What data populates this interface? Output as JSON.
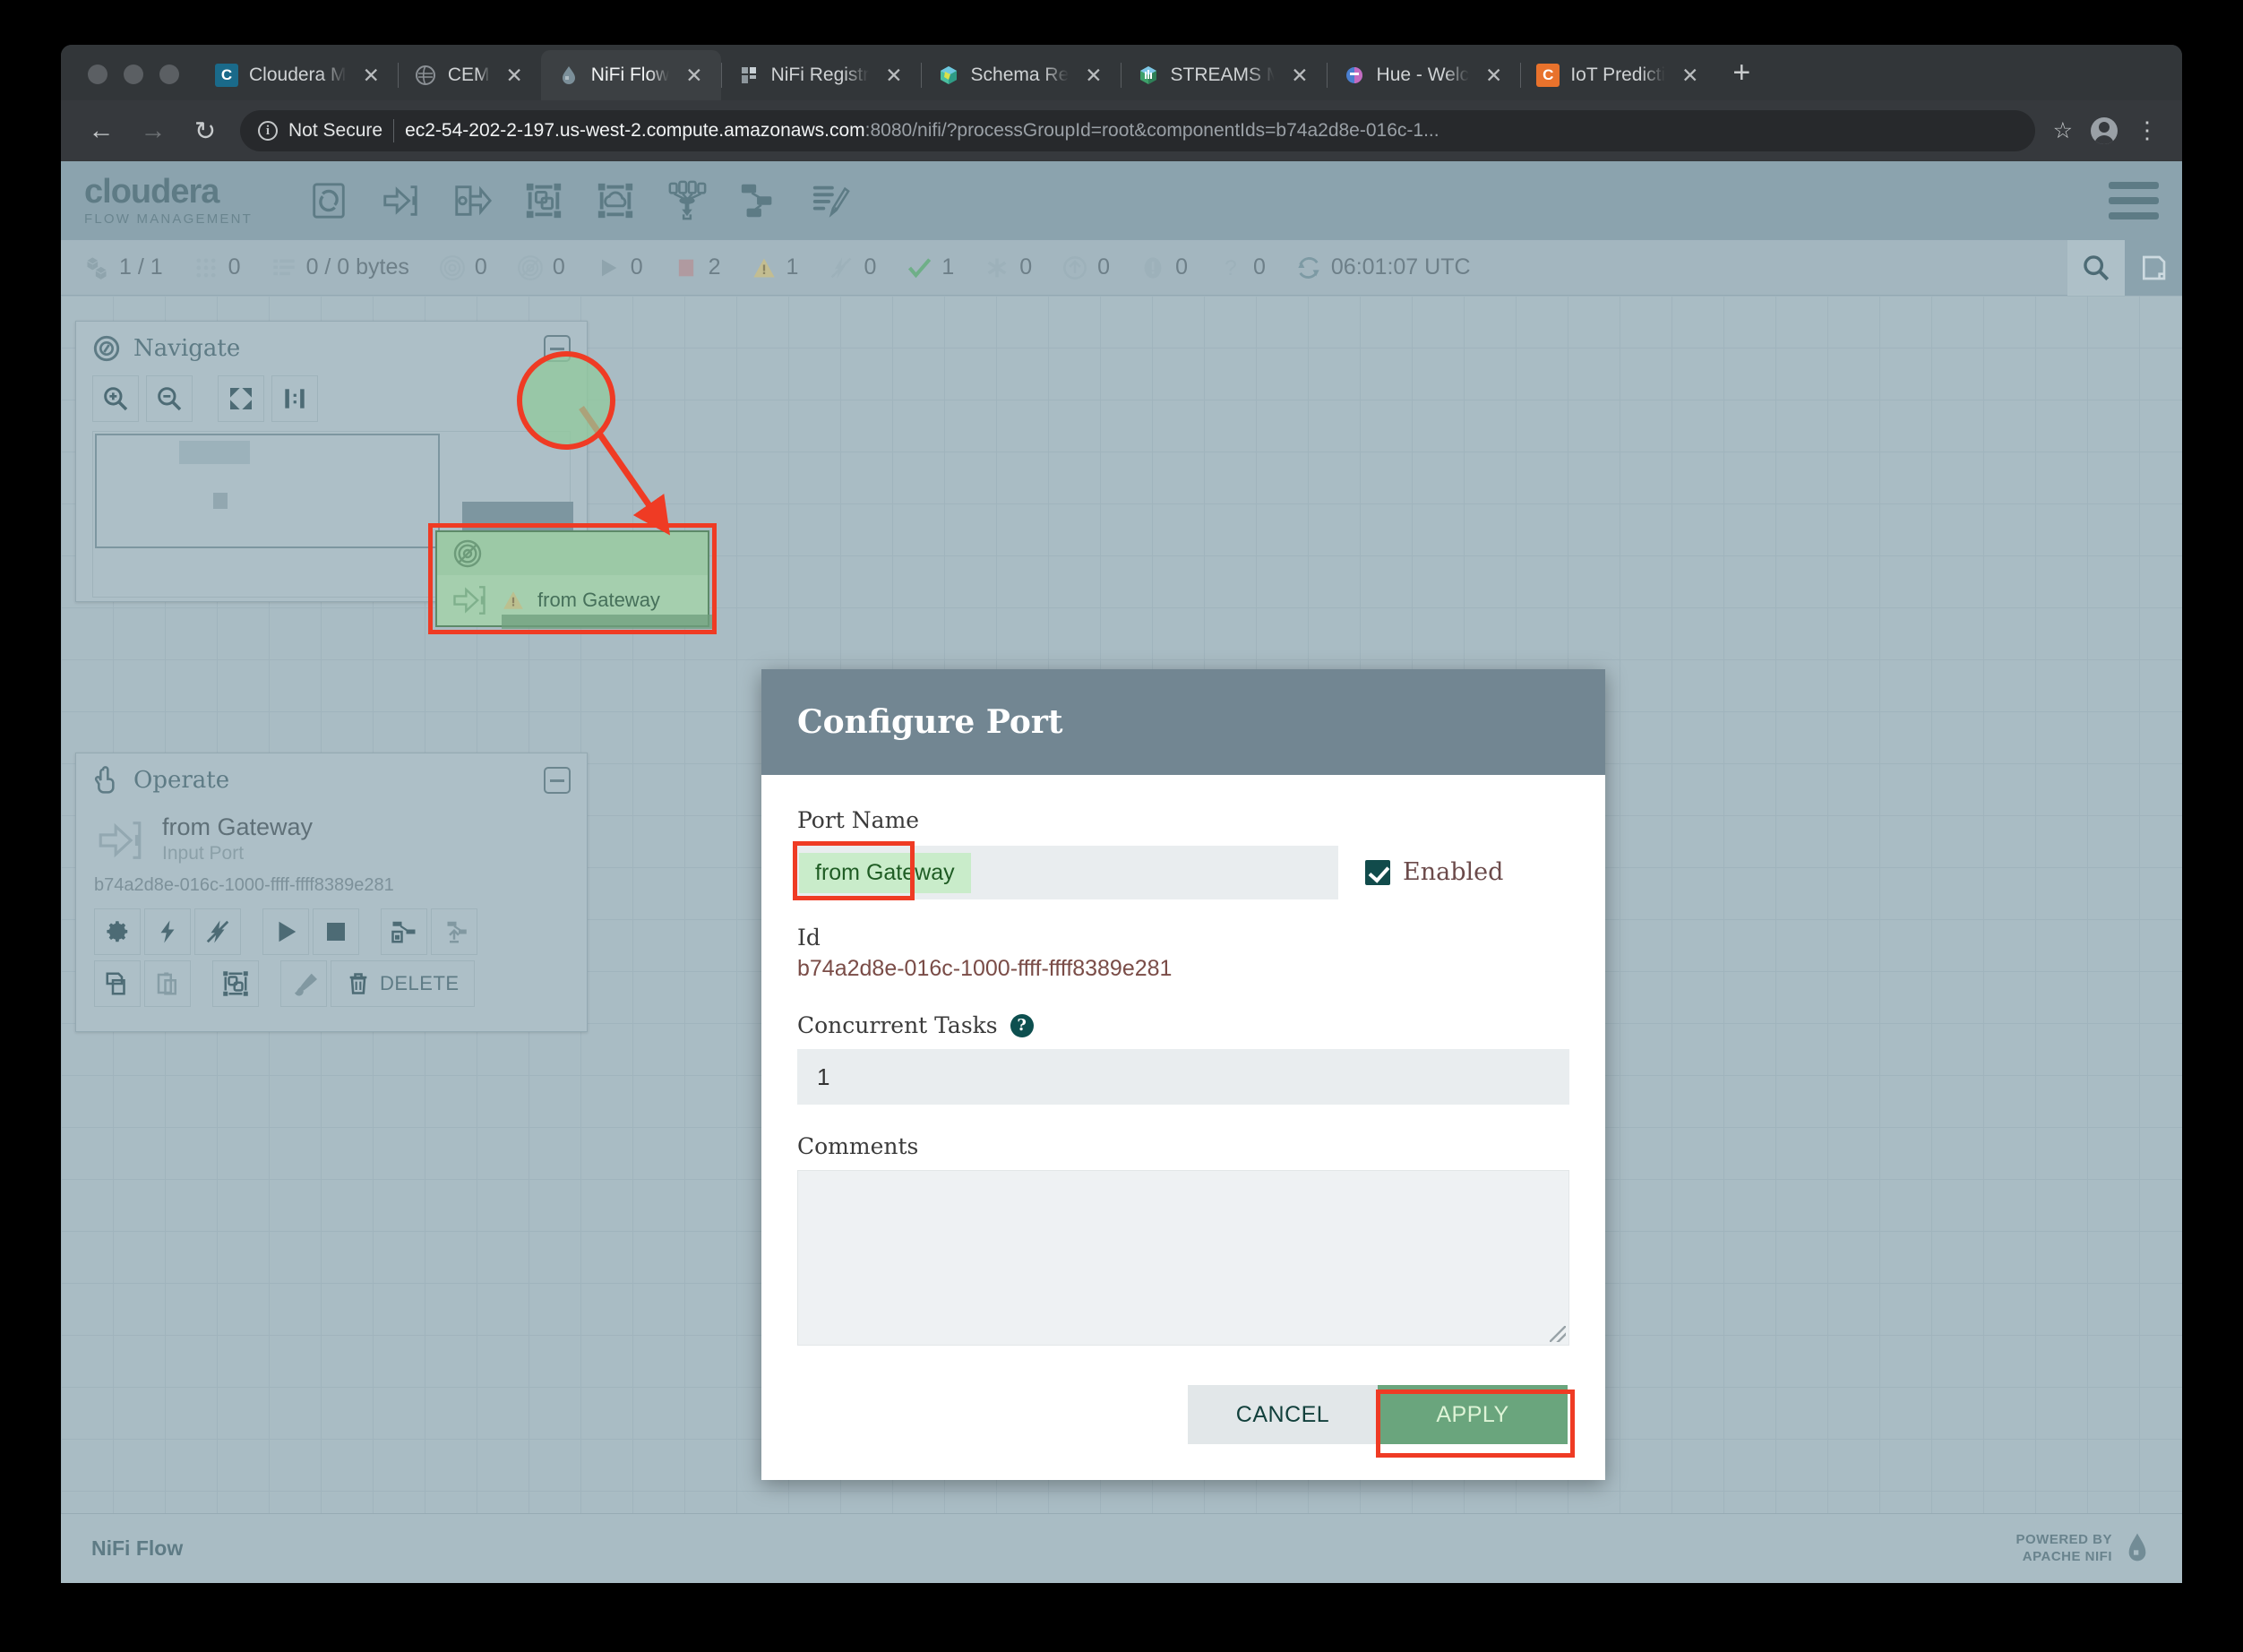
{
  "browser": {
    "tabs": [
      {
        "title": "Cloudera M",
        "icon": "cloudera-favicon",
        "active": false,
        "close": "✕"
      },
      {
        "title": "CEM",
        "icon": "cem-favicon",
        "active": false,
        "close": "✕"
      },
      {
        "title": "NiFi Flow",
        "icon": "nifi-favicon",
        "active": true,
        "close": "✕"
      },
      {
        "title": "NiFi Registr",
        "icon": "nifi-registry-favicon",
        "active": false,
        "close": "✕"
      },
      {
        "title": "Schema Re",
        "icon": "schema-registry-favicon",
        "active": false,
        "close": "✕"
      },
      {
        "title": "STREAMS M",
        "icon": "streams-favicon",
        "active": false,
        "close": "✕"
      },
      {
        "title": "Hue - Welc",
        "icon": "hue-favicon",
        "active": false,
        "close": "✕"
      },
      {
        "title": "IoT Predicti",
        "icon": "iot-favicon",
        "active": false,
        "close": "✕"
      }
    ],
    "new_tab_label": "+",
    "nav": {
      "back": "←",
      "forward": "→",
      "reload": "↻"
    },
    "security_label": "Not Secure",
    "url_host": "ec2-54-202-2-197.us-west-2.compute.amazonaws.com",
    "url_rest": ":8080/nifi/?processGroupId=root&componentIds=b74a2d8e-016c-1...",
    "bookmark_star": "☆",
    "menu_dots": "⋮"
  },
  "nifi": {
    "logo_main": "cloudera",
    "logo_sub": "FLOW MANAGEMENT",
    "toolbar": [
      {
        "name": "processor-tool",
        "label": "Processor"
      },
      {
        "name": "input-port-tool",
        "label": "Input Port"
      },
      {
        "name": "output-port-tool",
        "label": "Output Port"
      },
      {
        "name": "process-group-tool",
        "label": "Process Group"
      },
      {
        "name": "remote-process-group-tool",
        "label": "Remote Process Group"
      },
      {
        "name": "funnel-tool",
        "label": "Funnel"
      },
      {
        "name": "template-tool",
        "label": "Template"
      },
      {
        "name": "label-tool",
        "label": "Label"
      }
    ],
    "status": [
      {
        "name": "active-threads",
        "icon": "cubes-icon",
        "value": "1 / 1"
      },
      {
        "name": "queued-components",
        "icon": "dots-grid-icon",
        "value": "0"
      },
      {
        "name": "queued-flowfiles",
        "icon": "list-icon",
        "value": "0 / 0 bytes"
      },
      {
        "name": "transmitting-ports",
        "icon": "transmit-icon",
        "value": "0"
      },
      {
        "name": "not-transmitting-ports",
        "icon": "not-transmit-icon",
        "value": "0"
      },
      {
        "name": "running-components",
        "icon": "play-icon",
        "value": "0"
      },
      {
        "name": "stopped-components",
        "icon": "stop-icon",
        "value": "2"
      },
      {
        "name": "invalid-components",
        "icon": "warning-icon",
        "value": "1"
      },
      {
        "name": "disabled-components",
        "icon": "disabled-icon",
        "value": "0"
      },
      {
        "name": "up-to-date-versioned",
        "icon": "check-icon",
        "value": "1"
      },
      {
        "name": "locally-modified-versioned",
        "icon": "asterisk-icon",
        "value": "0"
      },
      {
        "name": "stale-versioned",
        "icon": "up-arrow-icon",
        "value": "0"
      },
      {
        "name": "locally-modified-and-stale",
        "icon": "exclamation-icon",
        "value": "0"
      },
      {
        "name": "sync-failure-versioned",
        "icon": "question-icon",
        "value": "0"
      },
      {
        "name": "last-refreshed",
        "icon": "refresh-icon",
        "value": "06:01:07 UTC"
      }
    ],
    "navigate_panel": {
      "title": "Navigate",
      "buttons": [
        {
          "name": "zoom-in-button",
          "icon": "zoom-in-icon"
        },
        {
          "name": "zoom-out-button",
          "icon": "zoom-out-icon"
        },
        {
          "name": "zoom-fit-button",
          "icon": "fit-icon"
        },
        {
          "name": "zoom-actual-button",
          "icon": "actual-size-icon"
        }
      ]
    },
    "operate_panel": {
      "title": "Operate",
      "component_name": "from Gateway",
      "component_type": "Input Port",
      "component_id": "b74a2d8e-016c-1000-ffff-ffff8389e281",
      "delete_label": "DELETE",
      "buttons": [
        {
          "name": "configure-button",
          "icon": "gear-icon"
        },
        {
          "name": "enable-button",
          "icon": "bolt-icon"
        },
        {
          "name": "disable-button",
          "icon": "bolt-slash-icon"
        },
        {
          "name": "start-button",
          "icon": "play-icon"
        },
        {
          "name": "stop-button",
          "icon": "stop-icon"
        },
        {
          "name": "version-button",
          "icon": "save-flow-icon"
        },
        {
          "name": "upload-button",
          "icon": "upload-flow-icon"
        },
        {
          "name": "copy-button",
          "icon": "copy-icon"
        },
        {
          "name": "paste-button",
          "icon": "paste-icon"
        },
        {
          "name": "group-button",
          "icon": "group-icon"
        },
        {
          "name": "color-button",
          "icon": "brush-icon"
        },
        {
          "name": "delete-button",
          "icon": "trash-icon"
        }
      ]
    },
    "canvas_node": {
      "label": "from Gateway",
      "bulletin_icon": "warning-icon",
      "transmit_icon": "not-transmitting-icon"
    },
    "footer": {
      "flow_name": "NiFi Flow",
      "powered_line1": "POWERED BY",
      "powered_line2": "APACHE NIFI"
    }
  },
  "dialog": {
    "title": "Configure Port",
    "port_name_label": "Port Name",
    "port_name_value": "from Gateway",
    "enabled_label": "Enabled",
    "enabled_checked": true,
    "id_label": "Id",
    "id_value": "b74a2d8e-016c-1000-ffff-ffff8389e281",
    "concurrent_tasks_label": "Concurrent Tasks",
    "concurrent_tasks_help": "?",
    "concurrent_tasks_value": "1",
    "comments_label": "Comments",
    "comments_value": "",
    "cancel_label": "CANCEL",
    "apply_label": "APPLY"
  },
  "annotations": {
    "highlight_color": "#ef3b24",
    "targets": [
      "input-port-tool",
      "canvas-node",
      "port-name-field",
      "apply-button"
    ]
  }
}
